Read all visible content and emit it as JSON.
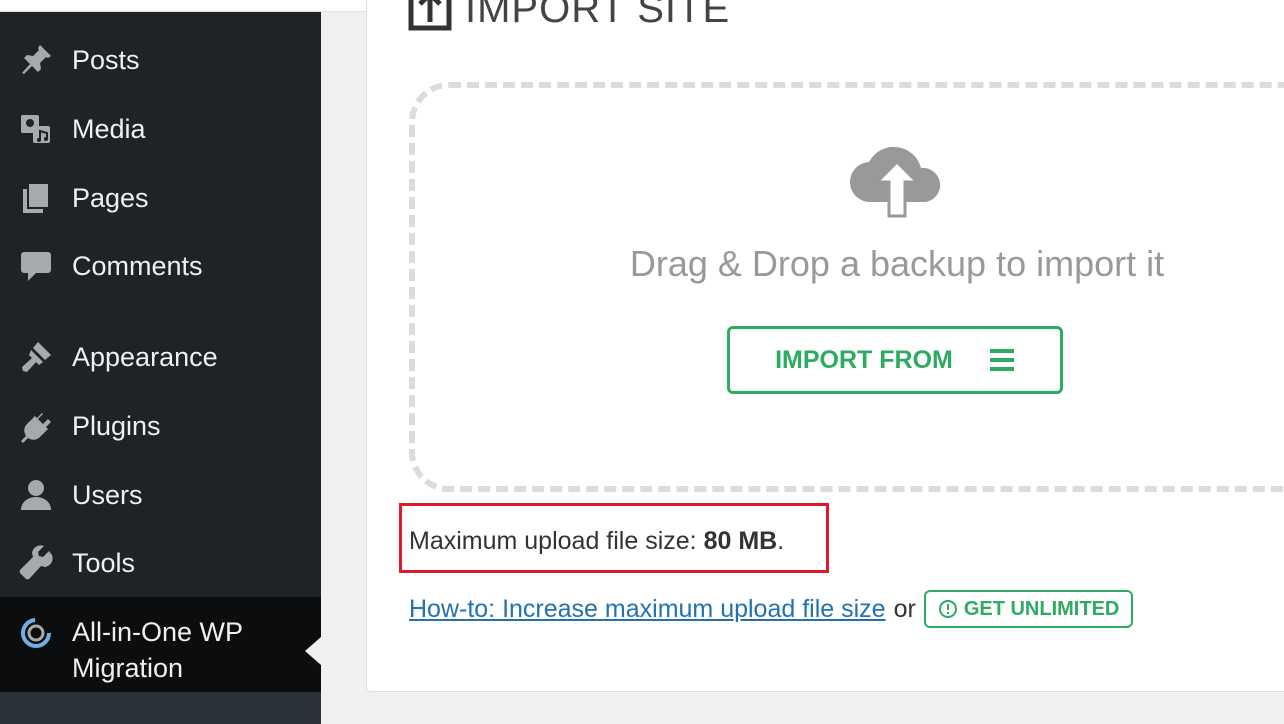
{
  "sidebar": {
    "items": [
      {
        "label": "Posts",
        "icon": "pin-icon"
      },
      {
        "label": "Media",
        "icon": "media-icon"
      },
      {
        "label": "Pages",
        "icon": "pages-icon"
      },
      {
        "label": "Comments",
        "icon": "comment-icon"
      },
      {
        "label": "Appearance",
        "icon": "paintbrush-icon"
      },
      {
        "label": "Plugins",
        "icon": "plugin-icon"
      },
      {
        "label": "Users",
        "icon": "user-icon"
      },
      {
        "label": "Tools",
        "icon": "wrench-icon"
      },
      {
        "label": "All-in-One WP Migration",
        "icon": "ai1wm-icon",
        "current": true
      }
    ]
  },
  "panel": {
    "title": "IMPORT SITE",
    "drop_text": "Drag & Drop a backup to import it",
    "import_button": "IMPORT FROM",
    "max_upload_prefix": "Maximum upload file size: ",
    "max_upload_value": "80 MB",
    "max_upload_suffix": ".",
    "howto_link": "How-to: Increase maximum upload file size",
    "or_text": "or",
    "unlimited_button": "GET UNLIMITED"
  },
  "colors": {
    "sidebar_bg": "#1d2327",
    "accent_green": "#2dab61",
    "link_blue": "#2271b1",
    "highlight_red": "#e0182b"
  }
}
